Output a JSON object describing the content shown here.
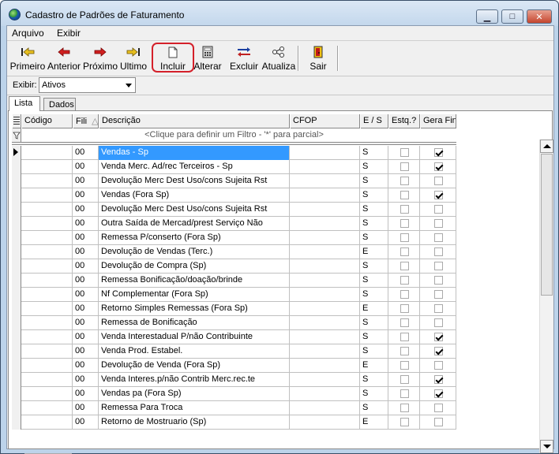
{
  "window": {
    "title": "Cadastro de Padrões de Faturamento",
    "controls": {
      "minimize": "▁",
      "maximize": "□",
      "close": "✕"
    }
  },
  "menu": {
    "items": [
      "Arquivo",
      "Exibir"
    ]
  },
  "toolbar": {
    "buttons": [
      {
        "label": "Primeiro",
        "icon": "first-record-icon"
      },
      {
        "label": "Anterior",
        "icon": "previous-record-icon"
      },
      {
        "label": "Próximo",
        "icon": "next-record-icon"
      },
      {
        "label": "Ultimo",
        "icon": "last-record-icon"
      },
      {
        "label": "Incluir",
        "icon": "new-document-icon"
      },
      {
        "label": "Alterar",
        "icon": "edit-calculator-icon"
      },
      {
        "label": "Excluir",
        "icon": "delete-arrows-icon"
      },
      {
        "label": "Atualiza",
        "icon": "refresh-network-icon"
      },
      {
        "label": "Sair",
        "icon": "exit-door-icon"
      }
    ],
    "highlight_color": "#d4202a"
  },
  "filter": {
    "label": "Exibir:",
    "value": "Ativos"
  },
  "tabs": [
    {
      "label": "Lista"
    },
    {
      "label": "Dados"
    }
  ],
  "grid": {
    "columns": [
      "Código",
      "Fili",
      "Descrição",
      "CFOP",
      "E / S",
      "Estq.?",
      "Gera Fin"
    ],
    "sort_glyph": "△",
    "filter_hint": "<Clique para definir um Filtro - '*' para parcial>",
    "selection_color": "#3399ff",
    "rows": [
      {
        "codigo": "",
        "fili": "00",
        "descricao": "Vendas - Sp",
        "cfop": "",
        "es": "S",
        "estq": false,
        "gera_fin": true
      },
      {
        "codigo": "",
        "fili": "00",
        "descricao": "Venda Merc. Ad/rec Terceiros - Sp",
        "cfop": "",
        "es": "S",
        "estq": false,
        "gera_fin": true
      },
      {
        "codigo": "",
        "fili": "00",
        "descricao": "Devolução Merc Dest Uso/cons Sujeita Rst",
        "cfop": "",
        "es": "S",
        "estq": false,
        "gera_fin": false
      },
      {
        "codigo": "",
        "fili": "00",
        "descricao": "Vendas (Fora Sp)",
        "cfop": "",
        "es": "S",
        "estq": false,
        "gera_fin": true
      },
      {
        "codigo": "",
        "fili": "00",
        "descricao": "Devolução Merc Dest Uso/cons Sujeita Rst",
        "cfop": "",
        "es": "S",
        "estq": false,
        "gera_fin": false
      },
      {
        "codigo": "",
        "fili": "00",
        "descricao": "Outra Saída de Mercad/prest Serviço Não",
        "cfop": "",
        "es": "S",
        "estq": false,
        "gera_fin": false
      },
      {
        "codigo": "",
        "fili": "00",
        "descricao": "Remessa P/conserto (Fora Sp)",
        "cfop": "",
        "es": "S",
        "estq": false,
        "gera_fin": false
      },
      {
        "codigo": "",
        "fili": "00",
        "descricao": "Devolução de Vendas (Terc.)",
        "cfop": "",
        "es": "E",
        "estq": false,
        "gera_fin": false
      },
      {
        "codigo": "",
        "fili": "00",
        "descricao": "Devolução de Compra (Sp)",
        "cfop": "",
        "es": "S",
        "estq": false,
        "gera_fin": false
      },
      {
        "codigo": "",
        "fili": "00",
        "descricao": "Remessa Bonificação/doação/brinde",
        "cfop": "",
        "es": "S",
        "estq": false,
        "gera_fin": false
      },
      {
        "codigo": "",
        "fili": "00",
        "descricao": "Nf Complementar (Fora Sp)",
        "cfop": "",
        "es": "S",
        "estq": false,
        "gera_fin": false
      },
      {
        "codigo": "",
        "fili": "00",
        "descricao": "Retorno Simples Remessas (Fora Sp)",
        "cfop": "",
        "es": "E",
        "estq": false,
        "gera_fin": false
      },
      {
        "codigo": "",
        "fili": "00",
        "descricao": "Remessa de Bonificação",
        "cfop": "",
        "es": "S",
        "estq": false,
        "gera_fin": false
      },
      {
        "codigo": "",
        "fili": "00",
        "descricao": "Venda Interestadual P/não Contribuinte",
        "cfop": "",
        "es": "S",
        "estq": false,
        "gera_fin": true
      },
      {
        "codigo": "",
        "fili": "00",
        "descricao": "Venda Prod. Estabel.",
        "cfop": "",
        "es": "S",
        "estq": false,
        "gera_fin": true
      },
      {
        "codigo": "",
        "fili": "00",
        "descricao": "Devolução de Venda (Fora Sp)",
        "cfop": "",
        "es": "E",
        "estq": false,
        "gera_fin": false
      },
      {
        "codigo": "",
        "fili": "00",
        "descricao": "Venda Interes.p/não Contrib Merc.rec.te",
        "cfop": "",
        "es": "S",
        "estq": false,
        "gera_fin": true
      },
      {
        "codigo": "",
        "fili": "00",
        "descricao": "Vendas    pa (Fora Sp)",
        "cfop": "",
        "es": "S",
        "estq": false,
        "gera_fin": true
      },
      {
        "codigo": "",
        "fili": "00",
        "descricao": "Remessa Para Troca",
        "cfop": "",
        "es": "S",
        "estq": false,
        "gera_fin": false
      },
      {
        "codigo": "",
        "fili": "00",
        "descricao": "Retorno de Mostruario (Sp)",
        "cfop": "",
        "es": "E",
        "estq": false,
        "gera_fin": false
      }
    ]
  }
}
